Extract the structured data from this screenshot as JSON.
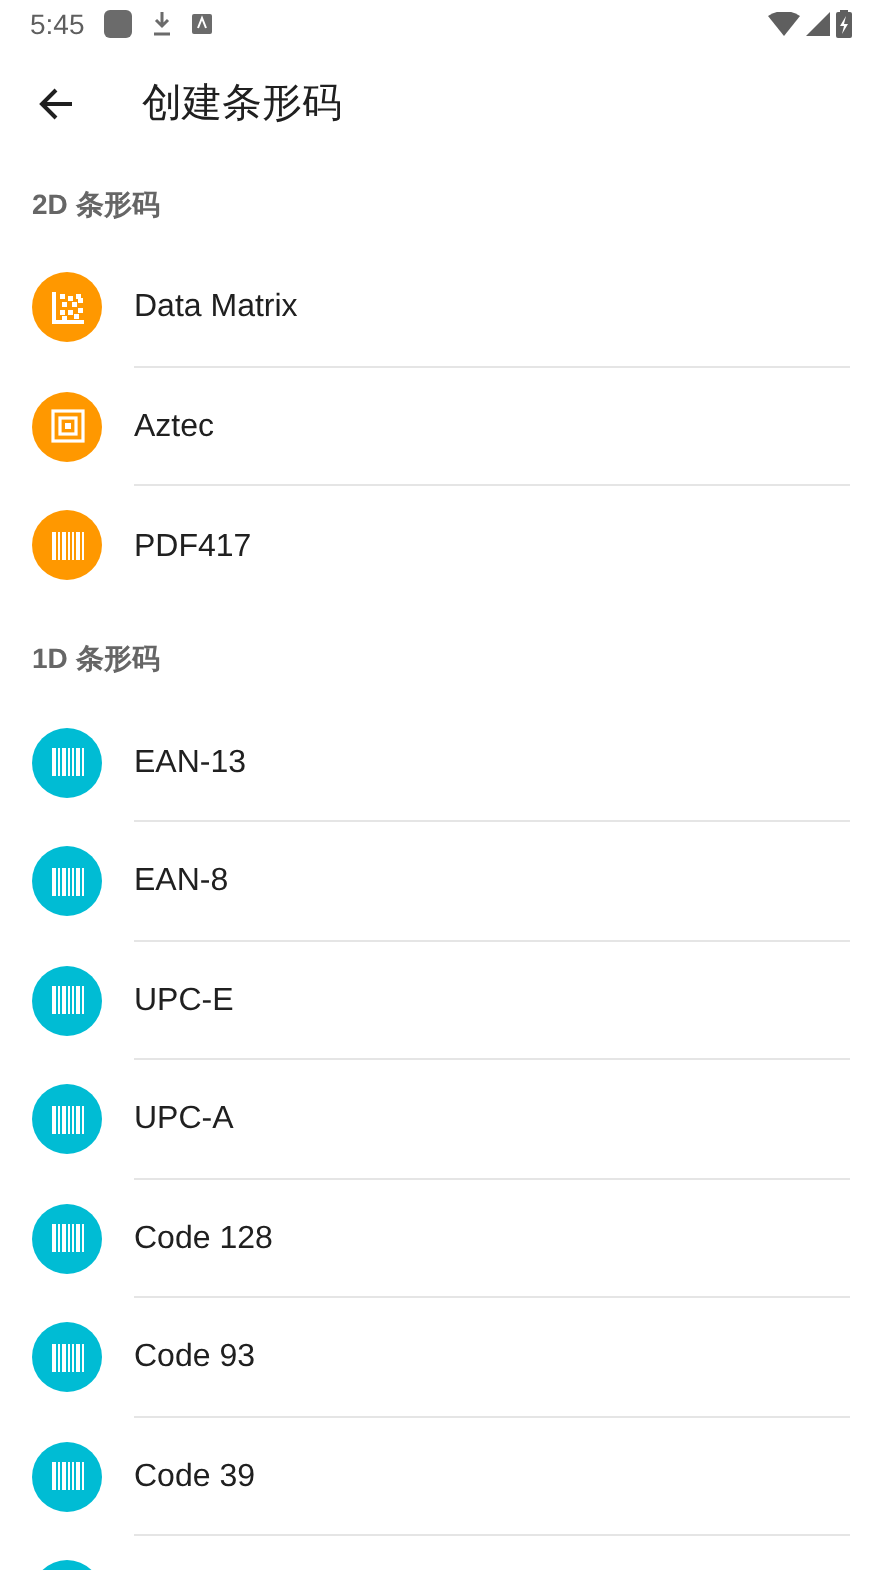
{
  "status_bar": {
    "time": "5:45"
  },
  "toolbar": {
    "title": "创建条形码"
  },
  "sections": [
    {
      "title": "2D 条形码",
      "color": "#ff9800",
      "items": [
        {
          "label": "Data Matrix",
          "kind": "matrix"
        },
        {
          "label": "Aztec",
          "kind": "aztec"
        },
        {
          "label": "PDF417",
          "kind": "linear"
        }
      ]
    },
    {
      "title": "1D 条形码",
      "color": "#00bcd4",
      "items": [
        {
          "label": "EAN-13",
          "kind": "linear"
        },
        {
          "label": "EAN-8",
          "kind": "linear"
        },
        {
          "label": "UPC-E",
          "kind": "linear"
        },
        {
          "label": "UPC-A",
          "kind": "linear"
        },
        {
          "label": "Code 128",
          "kind": "linear"
        },
        {
          "label": "Code 93",
          "kind": "linear"
        },
        {
          "label": "Code 39",
          "kind": "linear"
        }
      ],
      "more_below": true
    }
  ]
}
